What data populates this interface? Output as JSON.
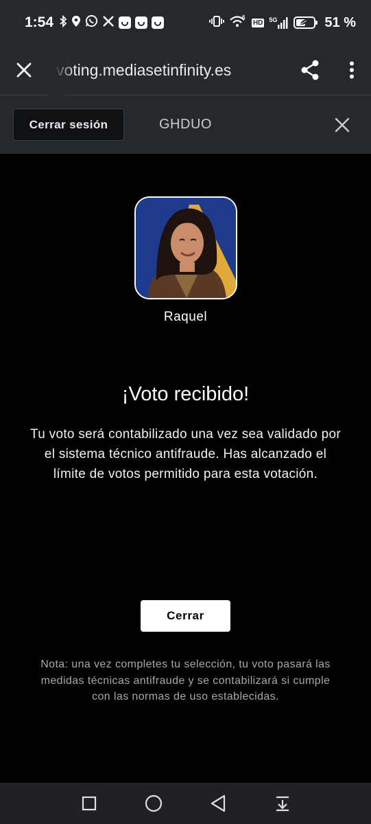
{
  "status_bar": {
    "time": "1:54",
    "battery_level": 0.51,
    "battery_percent": "51 %",
    "network": "5G",
    "hd_badge": "HD",
    "left_icons": [
      "bluetooth-icon",
      "location-icon",
      "whatsapp-icon",
      "x-app-icon",
      "app-icon",
      "app-icon",
      "app-icon"
    ],
    "right_icons": [
      "vibrate-icon",
      "wifi-6-icon",
      "hd-icon",
      "signal-5g-icon",
      "battery-saver-icon"
    ]
  },
  "browser": {
    "url": "voting.mediasetinfinity.es",
    "close_icon": "close-icon",
    "share_icon": "share-icon",
    "menu_icon": "more-vert-icon"
  },
  "header": {
    "logout_label": "Cerrar sesión",
    "show_name": "GHDUO",
    "close_icon": "close-icon"
  },
  "candidate": {
    "name": "Raquel"
  },
  "confirmation": {
    "title": "¡Voto recibido!",
    "message": "Tu voto será contabilizado una vez sea validado por el sistema técnico antifraude. Has alcanzado el límite de votos permitido para esta votación.",
    "close_button": "Cerrar",
    "note": "Nota: una vez completes tu selección, tu voto pasará las medidas técnicas antifraude y se contabilizará si cumple con las normas de uso establecidas."
  },
  "nav_bar": {
    "icons": [
      "recents-square-icon",
      "home-circle-icon",
      "back-triangle-icon",
      "notification-pull-down-icon"
    ]
  },
  "colors": {
    "chrome_bg": "#24292e",
    "page_bg": "#000000",
    "note_text": "#a9a9a9",
    "button_bg": "#ffffff"
  }
}
